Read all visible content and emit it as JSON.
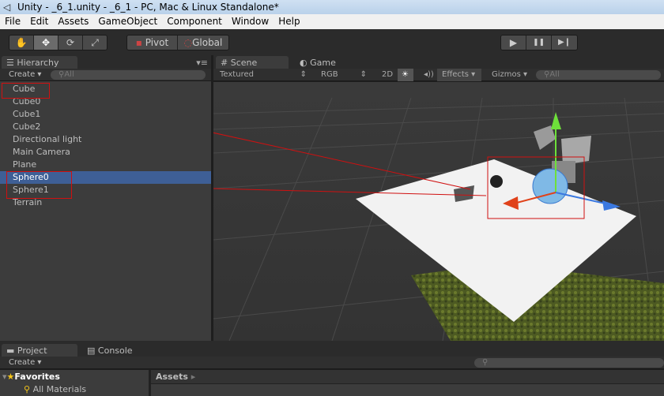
{
  "window": {
    "title": "Unity - _6_1.unity - _6_1 - PC, Mac & Linux Standalone*"
  },
  "menu": [
    "File",
    "Edit",
    "Assets",
    "GameObject",
    "Component",
    "Window",
    "Help"
  ],
  "toolbar": {
    "tools": [
      "✋",
      "✥",
      "⟳",
      "⤢"
    ],
    "pivot": "Pivot",
    "global": "Global",
    "play": "▶",
    "pause": "❚❚",
    "step": "▶❙"
  },
  "hierarchy": {
    "tab": "Hierarchy",
    "create": "Create",
    "search": "All",
    "items": [
      "Cube",
      "Cube0",
      "Cube1",
      "Cube2",
      "Directional light",
      "Main Camera",
      "Plane",
      "Sphere0",
      "Sphere1",
      "Terrain"
    ],
    "selected": "Sphere0"
  },
  "scene": {
    "tab_scene": "Scene",
    "tab_game": "Game",
    "render_mode": "Textured",
    "color_mode": "RGB",
    "mode_2d": "2D",
    "effects": "Effects",
    "gizmos": "Gizmos",
    "search": "All"
  },
  "project": {
    "tab_project": "Project",
    "tab_console": "Console",
    "create": "Create",
    "favorites": "Favorites",
    "all_materials": "All Materials",
    "breadcrumb": "Assets"
  },
  "colors": {
    "selection": "#3e5f96",
    "annotation": "#d01010"
  }
}
